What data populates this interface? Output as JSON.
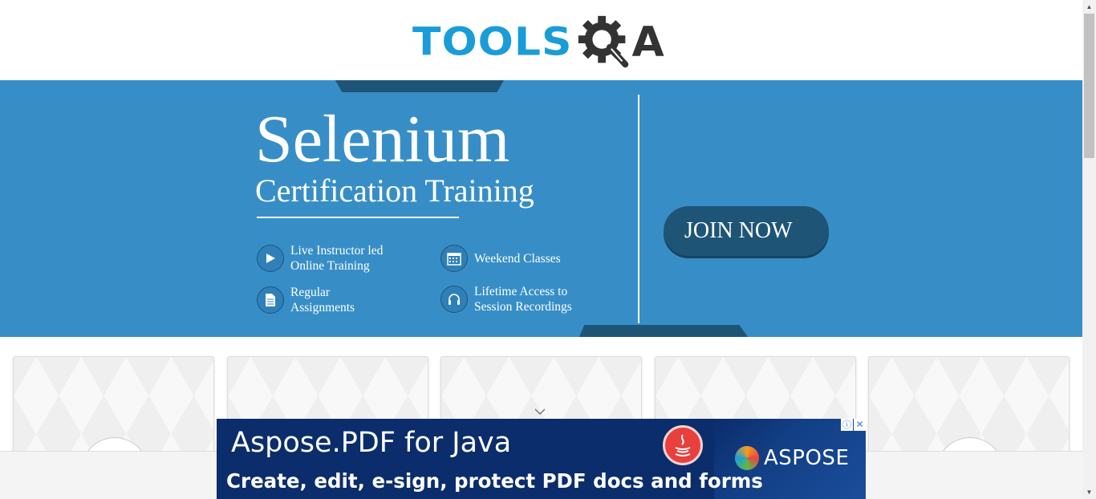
{
  "header": {
    "logo_tools": "TOOLS",
    "logo_a": "A"
  },
  "banner": {
    "title": "Selenium",
    "subtitle": "Certification Training",
    "join_label": "JOIN NOW",
    "features": [
      {
        "icon": "play-icon",
        "line1": "Live Instructor led",
        "line2": "Online Training"
      },
      {
        "icon": "calendar-icon",
        "line1": "Weekend Classes",
        "line2": ""
      },
      {
        "icon": "document-icon",
        "line1": "Regular",
        "line2": "Assignments"
      },
      {
        "icon": "headphones-icon",
        "line1": "Lifetime Access to",
        "line2": "Session Recordings"
      }
    ],
    "colors": {
      "banner_bg": "#378ec7",
      "dark": "#1e5576",
      "logo_blue": "#1a9cd8"
    }
  },
  "ad": {
    "title": "Aspose.PDF for Java",
    "subtitle": "Create, edit, e-sign, protect PDF docs and forms",
    "brand": "ASPOSE",
    "info_glyph": "ⓘ",
    "close_glyph": "✕"
  }
}
